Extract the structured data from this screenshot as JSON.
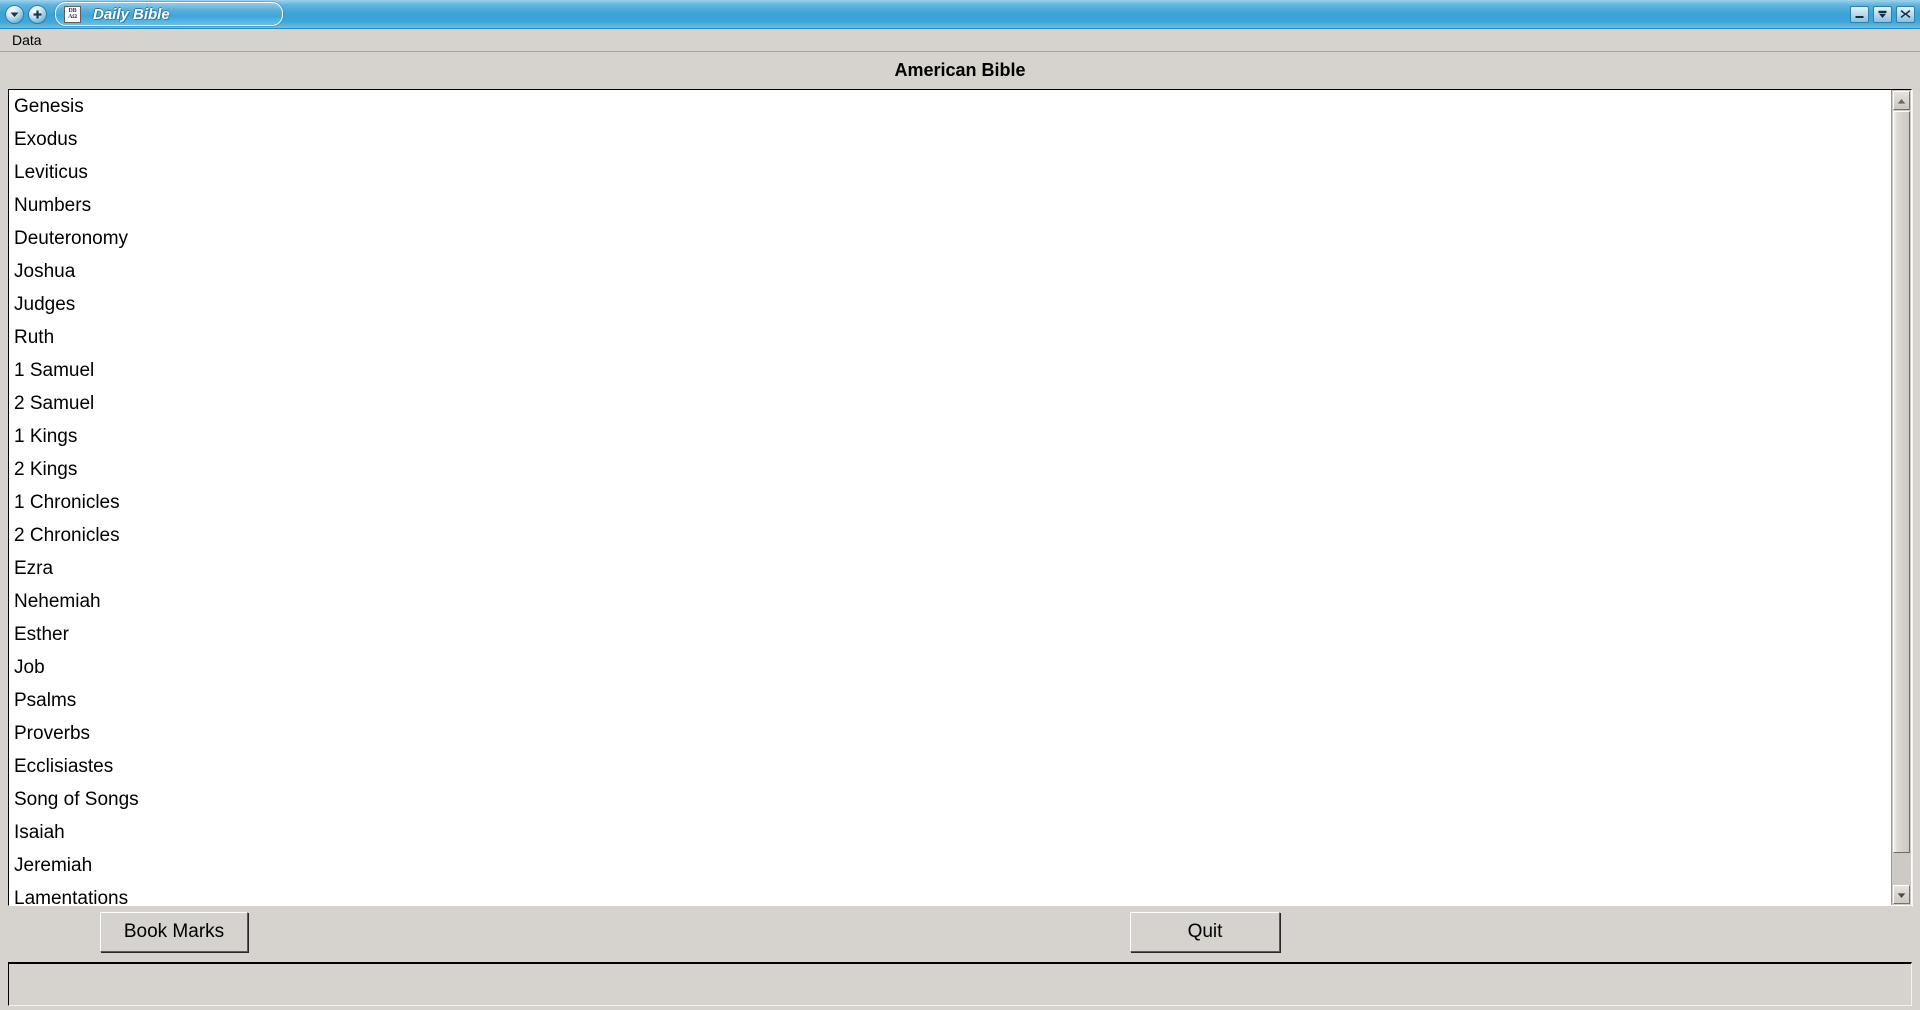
{
  "window": {
    "title": "Daily Bible",
    "app_icon_line1": "DB",
    "app_icon_line2": "AΩ",
    "left_controls": [
      {
        "name": "window-menu-chevron",
        "icon": "chevron-down-icon"
      },
      {
        "name": "window-shade-plus",
        "icon": "plus-icon"
      }
    ],
    "right_controls": [
      {
        "name": "minimize-button",
        "icon": "minimize-icon"
      },
      {
        "name": "maximize-button",
        "icon": "maximize-down-icon"
      },
      {
        "name": "close-button",
        "icon": "close-icon"
      }
    ],
    "titlebar_color": "#3ba2d6",
    "chrome_color": "#d6d2cd"
  },
  "menubar": {
    "items": [
      {
        "label": "Data"
      }
    ]
  },
  "header": {
    "title": "American Bible"
  },
  "booklist": {
    "items": [
      "Genesis",
      "Exodus",
      "Leviticus",
      "Numbers",
      "Deuteronomy",
      "Joshua",
      "Judges",
      "Ruth",
      "1 Samuel",
      "2 Samuel",
      "1 Kings",
      "2 Kings",
      "1 Chronicles",
      "2 Chronicles",
      "Ezra",
      "Nehemiah",
      "Esther",
      "Job",
      "Psalms",
      "Proverbs",
      "Ecclisiastes",
      "Song of Songs",
      "Isaiah",
      "Jeremiah",
      "Lamentations"
    ]
  },
  "scrollbar": {
    "up_arrow": "scroll-up-icon",
    "down_arrow": "scroll-down-icon",
    "thumb_position": "top"
  },
  "buttons": {
    "bookmarks_label": "Book Marks",
    "quit_label": "Quit"
  },
  "statusbar": {
    "text": ""
  }
}
